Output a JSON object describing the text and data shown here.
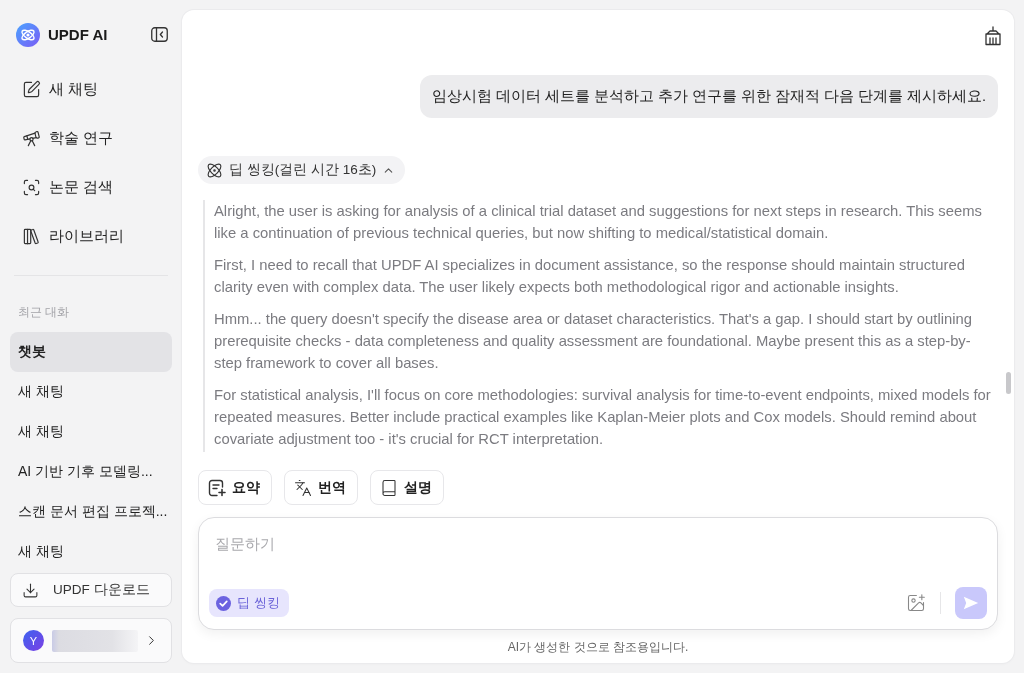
{
  "sidebar": {
    "brand": "UPDF AI",
    "nav": [
      {
        "label": "새 채팅"
      },
      {
        "label": "학술 연구"
      },
      {
        "label": "논문 검색"
      },
      {
        "label": "라이브러리"
      }
    ],
    "recent_heading": "최근 대화",
    "recent": [
      {
        "label": "챗봇",
        "selected": true
      },
      {
        "label": "새 채팅",
        "selected": false
      },
      {
        "label": "새 채팅",
        "selected": false
      },
      {
        "label": "AI 기반 기후 모델링...",
        "selected": false
      },
      {
        "label": "스캔 문서 편집 프로젝...",
        "selected": false
      },
      {
        "label": "새 채팅",
        "selected": false
      }
    ],
    "download_button": "UPDF 다운로드",
    "user": {
      "avatar_initial": "Y"
    }
  },
  "chat": {
    "user_message": "임상시험 데이터 세트를 분석하고 추가 연구를 위한 잠재적 다음 단계를 제시하세요.",
    "thinking": {
      "label": "딥 씽킹(걸린 시간 16초)",
      "expanded": true,
      "paragraphs": [
        "Alright, the user is asking for analysis of a clinical trial dataset and suggestions for next steps in research. This seems like a continuation of previous technical queries, but now shifting to medical/statistical domain.",
        "First, I need to recall that UPDF AI specializes in document assistance, so the response should maintain structured clarity even with complex data. The user likely expects both methodological rigor and actionable insights.",
        "Hmm... the query doesn't specify the disease area or dataset characteristics. That's a gap. I should start by outlining prerequisite checks - data completeness and quality assessment are foundational. Maybe present this as a step-by-step framework to cover all bases.",
        "For statistical analysis, I'll focus on core methodologies: survival analysis for time-to-event endpoints, mixed models for repeated measures. Better include practical examples like Kaplan-Meier plots and Cox models. Should remind about covariate adjustment too - it's crucial for RCT interpretation."
      ]
    },
    "actions": [
      "요약",
      "번역",
      "설명"
    ],
    "composer": {
      "placeholder": "질문하기",
      "deep_thinking": {
        "label": "딥 씽킹",
        "on": true
      },
      "send_disabled": true
    },
    "disclaimer": "AI가 생성한 것으로 참조용입니다."
  }
}
